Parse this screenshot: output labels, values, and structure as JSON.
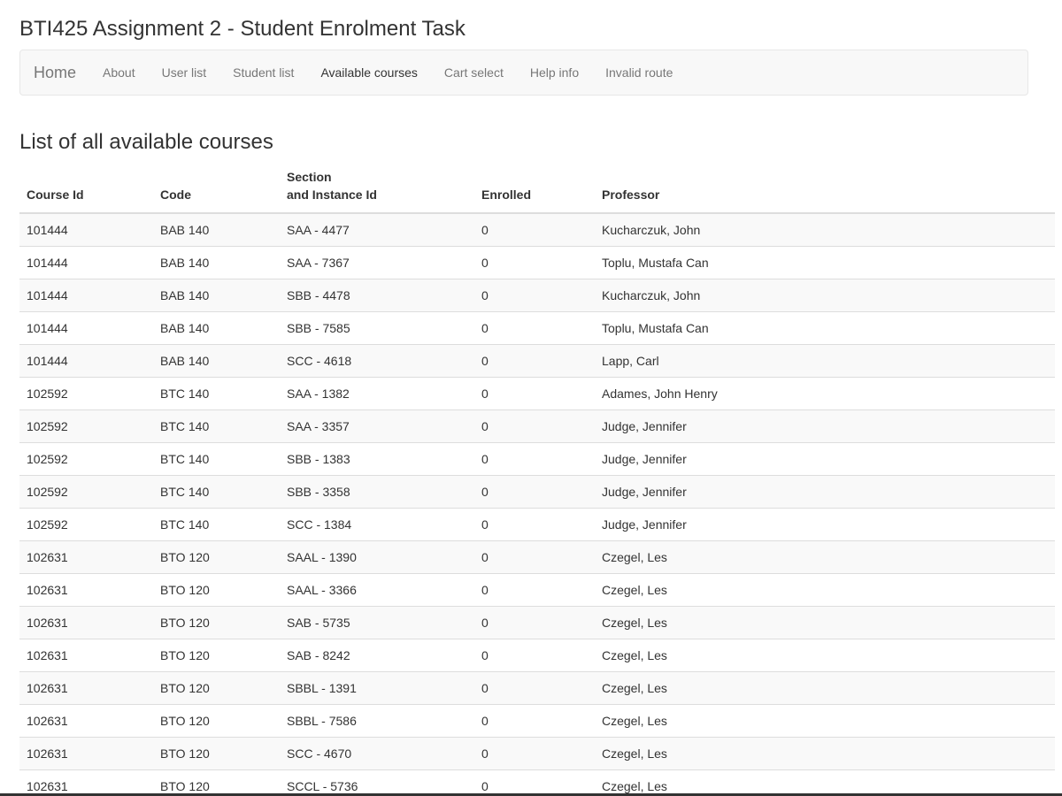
{
  "app": {
    "title": "BTI425 Assignment 2 - Student Enrolment Task"
  },
  "navbar": {
    "brand": "Home",
    "links": [
      {
        "label": "About"
      },
      {
        "label": "User list"
      },
      {
        "label": "Student list"
      },
      {
        "label": "Available courses",
        "active": true
      },
      {
        "label": "Cart select"
      },
      {
        "label": "Help info"
      },
      {
        "label": "Invalid route"
      }
    ]
  },
  "main": {
    "heading": "List of all available courses",
    "table": {
      "headers": {
        "course_id": "Course Id",
        "code": "Code",
        "section_line1": "Section",
        "section_line2": "and Instance Id",
        "enrolled": "Enrolled",
        "professor": "Professor"
      },
      "rows": [
        {
          "course_id": "101444",
          "code": "BAB 140",
          "section": "SAA - 4477",
          "enrolled": "0",
          "professor": "Kucharczuk, John"
        },
        {
          "course_id": "101444",
          "code": "BAB 140",
          "section": "SAA - 7367",
          "enrolled": "0",
          "professor": "Toplu, Mustafa Can"
        },
        {
          "course_id": "101444",
          "code": "BAB 140",
          "section": "SBB - 4478",
          "enrolled": "0",
          "professor": "Kucharczuk, John"
        },
        {
          "course_id": "101444",
          "code": "BAB 140",
          "section": "SBB - 7585",
          "enrolled": "0",
          "professor": "Toplu, Mustafa Can"
        },
        {
          "course_id": "101444",
          "code": "BAB 140",
          "section": "SCC - 4618",
          "enrolled": "0",
          "professor": "Lapp, Carl"
        },
        {
          "course_id": "102592",
          "code": "BTC 140",
          "section": "SAA - 1382",
          "enrolled": "0",
          "professor": "Adames, John Henry"
        },
        {
          "course_id": "102592",
          "code": "BTC 140",
          "section": "SAA - 3357",
          "enrolled": "0",
          "professor": "Judge, Jennifer"
        },
        {
          "course_id": "102592",
          "code": "BTC 140",
          "section": "SBB - 1383",
          "enrolled": "0",
          "professor": "Judge, Jennifer"
        },
        {
          "course_id": "102592",
          "code": "BTC 140",
          "section": "SBB - 3358",
          "enrolled": "0",
          "professor": "Judge, Jennifer"
        },
        {
          "course_id": "102592",
          "code": "BTC 140",
          "section": "SCC - 1384",
          "enrolled": "0",
          "professor": "Judge, Jennifer"
        },
        {
          "course_id": "102631",
          "code": "BTO 120",
          "section": "SAAL - 1390",
          "enrolled": "0",
          "professor": "Czegel, Les"
        },
        {
          "course_id": "102631",
          "code": "BTO 120",
          "section": "SAAL - 3366",
          "enrolled": "0",
          "professor": "Czegel, Les"
        },
        {
          "course_id": "102631",
          "code": "BTO 120",
          "section": "SAB - 5735",
          "enrolled": "0",
          "professor": "Czegel, Les"
        },
        {
          "course_id": "102631",
          "code": "BTO 120",
          "section": "SAB - 8242",
          "enrolled": "0",
          "professor": "Czegel, Les"
        },
        {
          "course_id": "102631",
          "code": "BTO 120",
          "section": "SBBL - 1391",
          "enrolled": "0",
          "professor": "Czegel, Les"
        },
        {
          "course_id": "102631",
          "code": "BTO 120",
          "section": "SBBL - 7586",
          "enrolled": "0",
          "professor": "Czegel, Les"
        },
        {
          "course_id": "102631",
          "code": "BTO 120",
          "section": "SCC - 4670",
          "enrolled": "0",
          "professor": "Czegel, Les"
        },
        {
          "course_id": "102631",
          "code": "BTO 120",
          "section": "SCCL - 5736",
          "enrolled": "0",
          "professor": "Czegel, Les"
        }
      ]
    }
  },
  "colors": {
    "text": "#333333",
    "nav_text": "#777777",
    "navbar_bg": "#f8f8f8",
    "stripe_bg": "#f9f9f9",
    "border": "#dddddd"
  }
}
